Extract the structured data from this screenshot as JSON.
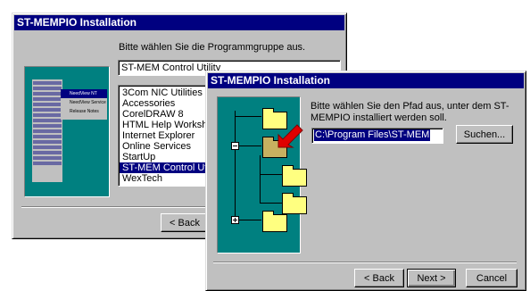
{
  "back_window": {
    "title": "ST-MEMPIO Installation",
    "instruction": "Bitte wählen Sie die Programmgruppe aus.",
    "group_field_value": "ST-MEM Control Utility",
    "program_groups": [
      "3Com NIC Utilities",
      "Accessories",
      "CorelDRAW 8",
      "HTML Help Workshop",
      "Internet Explorer",
      "Online Services",
      "StartUp",
      "ST-MEM Control Utility",
      "WexTech"
    ],
    "selected_group": "ST-MEM Control Utility",
    "back_button": "< Back",
    "preview_menu": [
      "NeedView NT",
      "NeedView Service",
      "Release Notes"
    ]
  },
  "front_window": {
    "title": "ST-MEMPIO Installation",
    "instruction": "Bitte wählen Sie den Pfad aus, unter dem ST-MEMPIO installiert werden soll.",
    "path_value": "C:\\Program Files\\ST-MEM",
    "browse_button": "Suchen...",
    "back_button": "< Back",
    "next_button": "Next >",
    "cancel_button": "Cancel"
  },
  "colors": {
    "titlebar": "#000080",
    "picture_bg": "#008080",
    "dialog_bg": "#c0c0c0",
    "arrow": "#e00000",
    "folder": "#ffff80"
  }
}
